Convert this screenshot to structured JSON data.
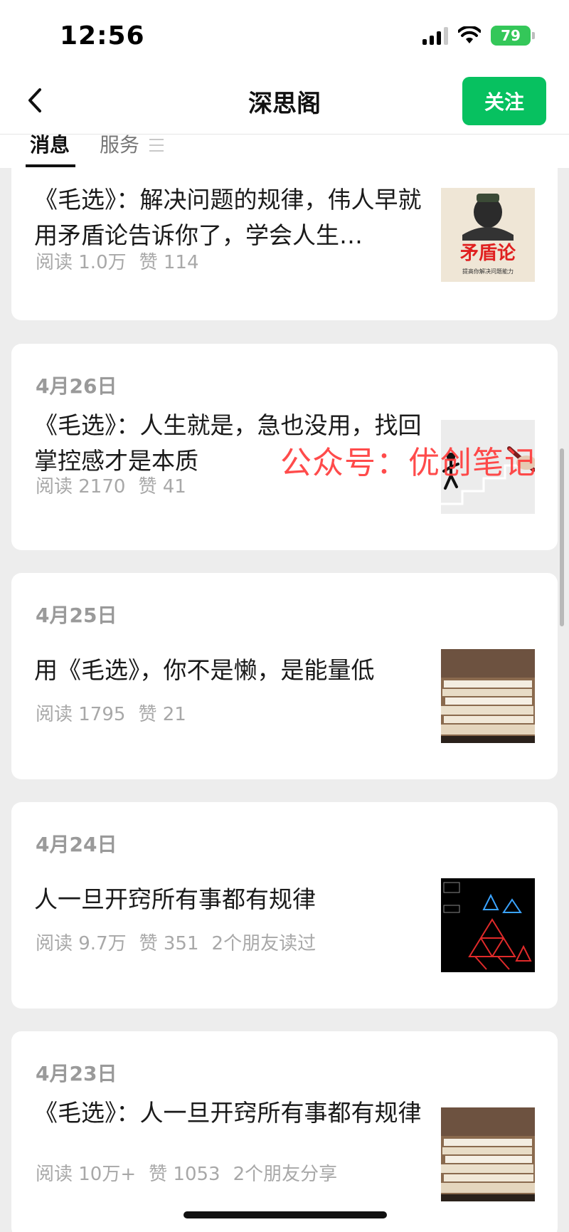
{
  "status": {
    "time": "12:56",
    "battery": "79"
  },
  "nav": {
    "title": "深思阁",
    "follow_label": "关注"
  },
  "tabs": {
    "messages": "消息",
    "services": "服务"
  },
  "watermark": "公众号：优创笔记",
  "articles": [
    {
      "date": "",
      "title": "《毛选》：解决问题的规律，伟人早就用矛盾论告诉你了，学会人生…",
      "reads": "阅读 1.0万",
      "likes": "赞 114",
      "extra": "",
      "thumb_text": "矛盾论",
      "thumb_caption": "提高你解决问题能力"
    },
    {
      "date": "4月26日",
      "title": "《毛选》：人生就是，急也没用，找回掌控感才是本质",
      "reads": "阅读 2170",
      "likes": "赞 41",
      "extra": ""
    },
    {
      "date": "4月25日",
      "title": "用《毛选》，你不是懒，是能量低",
      "reads": "阅读 1795",
      "likes": "赞 21",
      "extra": ""
    },
    {
      "date": "4月24日",
      "title": "人一旦开窍所有事都有规律",
      "reads": "阅读 9.7万",
      "likes": "赞 351",
      "extra": "2个朋友读过"
    },
    {
      "date": "4月23日",
      "title": "《毛选》：人一旦开窍所有事都有规律",
      "reads": "阅读 10万+",
      "likes": "赞 1053",
      "extra": "2个朋友分享"
    }
  ]
}
